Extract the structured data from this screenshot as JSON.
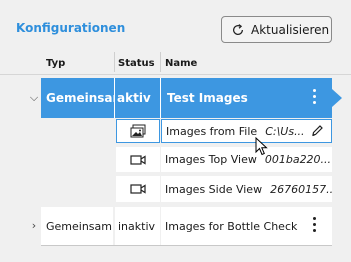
{
  "header": {
    "title": "Konfigurationen",
    "refresh_label": "Aktualisieren"
  },
  "columns": [
    "Typ",
    "Status",
    "Name"
  ],
  "rows": [
    {
      "type": "Gemeinsam",
      "status": "aktiv",
      "name": "Test Images",
      "expanded": true,
      "selected": true,
      "children": [
        {
          "icon": "image-icon",
          "name": "Images from File",
          "value": "C:\\Us...",
          "editing": true
        },
        {
          "icon": "camera-icon",
          "name": "Images Top View",
          "value": "001ba220..."
        },
        {
          "icon": "camera-icon",
          "name": "Images Side View",
          "value": "26760157..."
        }
      ]
    },
    {
      "type": "Gemeinsam",
      "status": "inaktiv",
      "name": "Images for Bottle Check",
      "expanded": false,
      "selected": false
    }
  ],
  "colors": {
    "accent": "#3d97e1",
    "title": "#2f8fdc",
    "background": "#f0f0f0"
  }
}
